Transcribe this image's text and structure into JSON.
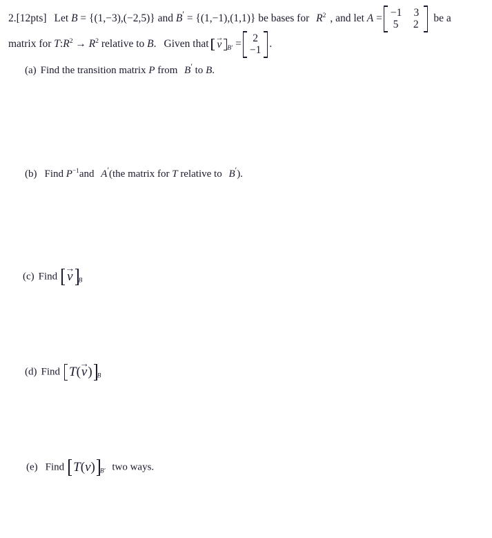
{
  "document": {
    "type": "math-worksheet-problem",
    "background_color": "#ffffff",
    "text_color": "#1a1a2e"
  },
  "problem": {
    "number": "2.",
    "points": "[12pts]",
    "line1": {
      "t_let": "Let",
      "basis_B_name": "B",
      "eq": "=",
      "basis_B_value": "{(1,−3),(−2,5)}",
      "t_and": "and",
      "basis_Bp_name": "B",
      "basis_Bp_prime": "′",
      "basis_Bp_value": "{(1,−1),(1,1)}",
      "t_bases_for": "be bases for",
      "space_R": "R",
      "space_exp": "2",
      "comma": ",",
      "t_and_let": "and let",
      "matrix_A_name": "A",
      "t_be_a": "be a"
    },
    "line2": {
      "t_matrix_for": "matrix for",
      "map_T": "T",
      "colon": ":",
      "dom_R": "R",
      "dom_exp": "2",
      "arrow": "→",
      "cod_R": "R",
      "cod_exp": "2",
      "t_relative_to": "relative to",
      "basis_B": "B",
      "period": ".",
      "t_given_that": "Given that",
      "vec_v": "v",
      "vec_accent": "→",
      "sub_Bp": "B",
      "sub_Bp_prime": "′",
      "eq": "=",
      "end_period": "."
    }
  },
  "matrices": {
    "A": {
      "label": "A",
      "rows": [
        [
          "−1",
          "3"
        ],
        [
          "5",
          "2"
        ]
      ]
    },
    "v_coords_Bprime": {
      "label": "[v]_B'",
      "rows": [
        [
          "2"
        ],
        [
          "−1"
        ]
      ]
    }
  },
  "parts": [
    {
      "id": "a",
      "label": "(a)",
      "text_1": "Find the transition matrix",
      "sym_P": "P",
      "text_2": "from",
      "sym_Bp": "B",
      "sym_Bp_prime": "′",
      "text_3": "to",
      "sym_B": "B",
      "text_4": "."
    },
    {
      "id": "b",
      "label": "(b)",
      "text_1": "Find",
      "sym_P": "P",
      "sym_P_exp": "−1",
      "text_2": "and",
      "sym_Ap": "A",
      "sym_Ap_prime": "′",
      "text_3": "(the matrix for",
      "sym_T": "T",
      "text_4": "relative to",
      "sym_Bp": "B",
      "sym_Bp_prime": "′",
      "text_5": ")."
    },
    {
      "id": "c",
      "label": "(c)",
      "text_1": "Find",
      "vec_v": "v",
      "vec_accent": "→",
      "sub_B": "B"
    },
    {
      "id": "d",
      "label": "(d)",
      "text_1": "Find",
      "sym_T": "T",
      "paren_open": "(",
      "vec_v": "v",
      "vec_accent": "→",
      "paren_close": ")",
      "sub_B": "B"
    },
    {
      "id": "e",
      "label": "(e)",
      "text_1": "Find",
      "sym_T": "T",
      "paren_open": "(",
      "sym_v": "v",
      "paren_close": ")",
      "sub_Bp": "B",
      "sub_Bp_prime": "′",
      "text_2": "two ways."
    }
  ]
}
